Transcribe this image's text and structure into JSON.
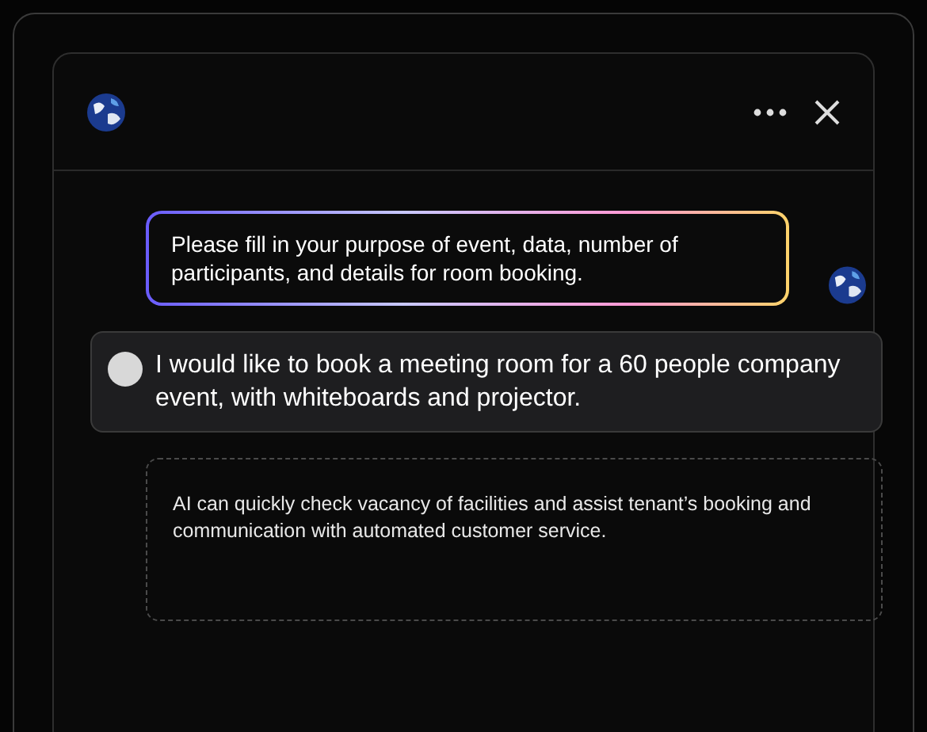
{
  "messages": [
    {
      "kind": "bot",
      "text": "Please fill in your purpose of event, data, number of participants, and details for room booking."
    },
    {
      "kind": "user",
      "text": "I would like to book a meeting room for a 60 people company event, with whiteboards and projector."
    },
    {
      "kind": "note",
      "text": "AI can quickly check vacancy of facilities and assist tenant’s booking and communication with automated customer service."
    }
  ]
}
